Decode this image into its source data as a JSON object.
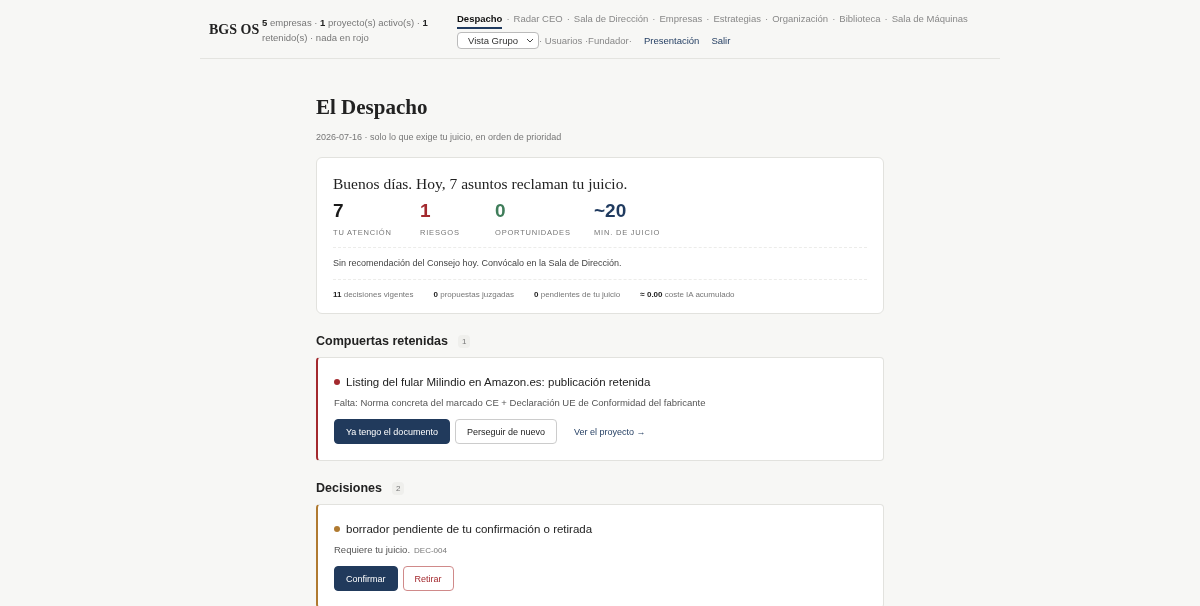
{
  "header": {
    "brand": "BGS OS",
    "summary": "**5** empresas · **1** proyecto(s) activo(s) · **1** retenido(s) · nada en rojo",
    "nav_separator": "·",
    "nav": [
      {
        "label": "Despacho",
        "selected": true
      },
      {
        "label": "Radar CEO",
        "selected": false
      },
      {
        "label": "Sala de Dirección",
        "selected": false
      },
      {
        "label": "Empresas",
        "selected": false
      },
      {
        "label": "Estrategias",
        "selected": false
      },
      {
        "label": "Organización",
        "selected": false
      },
      {
        "label": "Biblioteca",
        "selected": false
      },
      {
        "label": "Sala de Máquinas",
        "selected": false
      }
    ],
    "view_select": {
      "value": "Vista Grupo"
    },
    "user_text": "· Usuarios ·Fundador·",
    "links": [
      "Presentación",
      "Salir"
    ]
  },
  "page": {
    "title": "El Despacho",
    "subtitle": "2026-07-16 · solo lo que exige tu juicio, en orden de prioridad"
  },
  "summary": {
    "greeting": "Buenos días. Hoy, 7 asuntos reclaman tu juicio.",
    "stats": [
      {
        "value": "7",
        "label": "TU ATENCIÓN",
        "color": "#1a1a1a"
      },
      {
        "value": "1",
        "label": "RIESGOS",
        "color": "#a3292e"
      },
      {
        "value": "0",
        "label": "OPORTUNIDADES",
        "color": "#3f7d5a"
      },
      {
        "value": "~20",
        "label": "MIN. DE JUICIO",
        "color": "#1f3a5f"
      }
    ],
    "note": "Sin recomendación del Consejo hoy. Convócalo en la Sala de Dirección.",
    "footer": [
      "**11** decisiones vigentes",
      "**0** propuestas juzgadas",
      "**0** pendientes de tu juicio",
      "**≈ 0.00** coste IA acumulado"
    ]
  },
  "sections": [
    {
      "title": "Compuertas retenidas",
      "count": "1",
      "cards": [
        {
          "color": "#a3292e",
          "title": "Listing del fular Milindio en Amazon.es: publicación retenida",
          "detail": "Falta: Norma concreta del marcado CE + Declaración UE de Conformidad del fabricante",
          "buttons": [
            {
              "kind": "primary",
              "label": "Ya tengo el documento"
            },
            {
              "kind": "secondary",
              "label": "Perseguir de nuevo"
            },
            {
              "kind": "link",
              "label": "Ver el proyecto →"
            }
          ]
        }
      ]
    },
    {
      "title": "Decisiones",
      "count": "2",
      "cards": [
        {
          "color": "#b07a30",
          "title": "borrador pendiente de tu confirmación o retirada",
          "detail": "Requiere tu juicio.",
          "code": "DEC-004",
          "buttons": [
            {
              "kind": "primary",
              "label": "Confirmar"
            },
            {
              "kind": "danger",
              "label": "Retirar"
            }
          ]
        }
      ]
    }
  ]
}
